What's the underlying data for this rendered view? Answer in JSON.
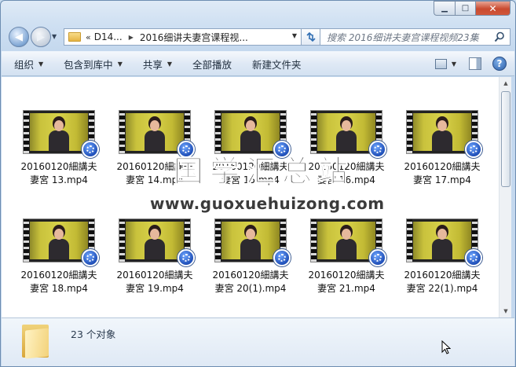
{
  "address": {
    "history_chevron": "«",
    "segments": [
      "D14...",
      "2016细讲夫妻宫课程视..."
    ]
  },
  "search": {
    "placeholder": "搜索 2016细讲夫妻宫课程视频23集"
  },
  "toolbar": {
    "organize": "组织",
    "include_in_library": "包含到库中",
    "share": "共享",
    "play_all": "全部播放",
    "new_folder": "新建文件夹"
  },
  "files": [
    {
      "line1": "20160120細講夫",
      "line2": "妻宮 13.mp4"
    },
    {
      "line1": "20160120細講夫",
      "line2": "妻宮 14.mp4"
    },
    {
      "line1": "20160120細講夫",
      "line2": "妻宮 15.mp4"
    },
    {
      "line1": "20160120細講夫",
      "line2": "妻宮 16.mp4"
    },
    {
      "line1": "20160120細講夫",
      "line2": "妻宮 17.mp4"
    },
    {
      "line1": "20160120細講夫",
      "line2": "妻宮 18.mp4"
    },
    {
      "line1": "20160120細講夫",
      "line2": "妻宮 19.mp4"
    },
    {
      "line1": "20160120細講夫",
      "line2": "妻宮 20(1).mp4"
    },
    {
      "line1": "20160120細講夫",
      "line2": "妻宮 21.mp4"
    },
    {
      "line1": "20160120細講夫",
      "line2": "妻宮 22(1).mp4"
    }
  ],
  "watermark": {
    "cn": "国学汇总站",
    "url": "www.guoxuehuizong.com"
  },
  "status": {
    "count": "23 个对象"
  },
  "icons": {
    "file": "video-file-thumbnail-icon",
    "badge": "media-player-classic-icon",
    "folder": "folder-icon"
  }
}
